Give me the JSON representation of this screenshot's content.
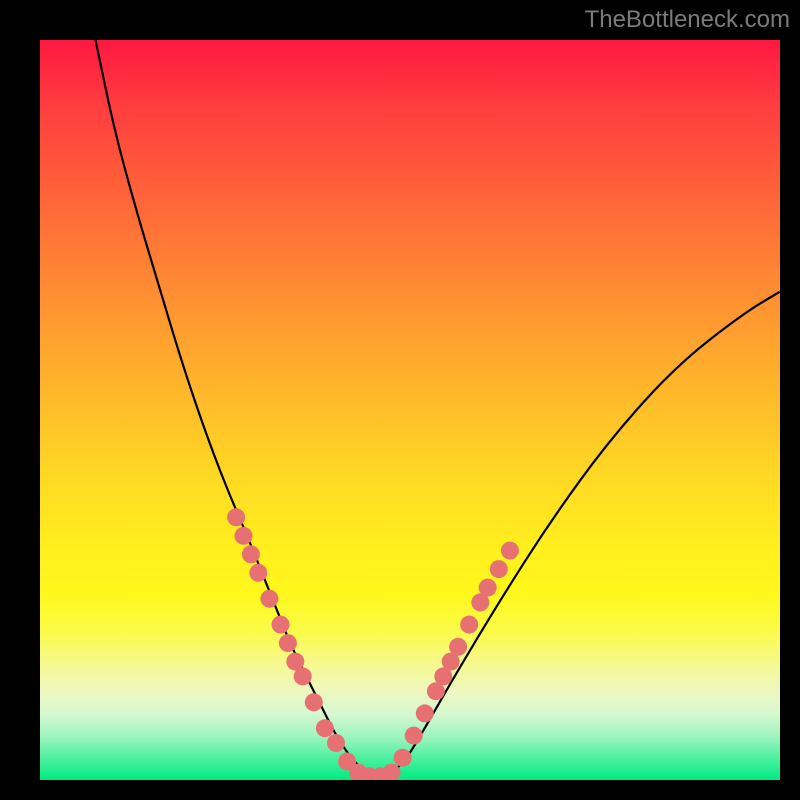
{
  "watermark": "TheBottleneck.com",
  "chart_data": {
    "type": "line",
    "title": "",
    "xlabel": "",
    "ylabel": "",
    "xlim": [
      0,
      1
    ],
    "ylim": [
      0,
      1
    ],
    "curve": {
      "x": [
        0.075,
        0.1,
        0.13,
        0.16,
        0.19,
        0.22,
        0.25,
        0.28,
        0.3,
        0.32,
        0.34,
        0.36,
        0.38,
        0.4,
        0.42,
        0.44,
        0.46,
        0.49,
        0.52,
        0.56,
        0.62,
        0.69,
        0.77,
        0.86,
        0.95,
        1.0
      ],
      "y": [
        1.0,
        0.88,
        0.77,
        0.67,
        0.57,
        0.48,
        0.4,
        0.33,
        0.28,
        0.23,
        0.18,
        0.14,
        0.1,
        0.06,
        0.03,
        0.01,
        0.0,
        0.02,
        0.07,
        0.14,
        0.24,
        0.35,
        0.46,
        0.56,
        0.63,
        0.66
      ]
    },
    "markers": [
      {
        "x": 0.265,
        "y": 0.355
      },
      {
        "x": 0.275,
        "y": 0.33
      },
      {
        "x": 0.285,
        "y": 0.305
      },
      {
        "x": 0.295,
        "y": 0.28
      },
      {
        "x": 0.31,
        "y": 0.245
      },
      {
        "x": 0.325,
        "y": 0.21
      },
      {
        "x": 0.335,
        "y": 0.185
      },
      {
        "x": 0.345,
        "y": 0.16
      },
      {
        "x": 0.355,
        "y": 0.14
      },
      {
        "x": 0.37,
        "y": 0.105
      },
      {
        "x": 0.385,
        "y": 0.07
      },
      {
        "x": 0.4,
        "y": 0.05
      },
      {
        "x": 0.415,
        "y": 0.025
      },
      {
        "x": 0.43,
        "y": 0.01
      },
      {
        "x": 0.445,
        "y": 0.005
      },
      {
        "x": 0.46,
        "y": 0.005
      },
      {
        "x": 0.475,
        "y": 0.01
      },
      {
        "x": 0.49,
        "y": 0.03
      },
      {
        "x": 0.505,
        "y": 0.06
      },
      {
        "x": 0.52,
        "y": 0.09
      },
      {
        "x": 0.535,
        "y": 0.12
      },
      {
        "x": 0.545,
        "y": 0.14
      },
      {
        "x": 0.555,
        "y": 0.16
      },
      {
        "x": 0.565,
        "y": 0.18
      },
      {
        "x": 0.58,
        "y": 0.21
      },
      {
        "x": 0.595,
        "y": 0.24
      },
      {
        "x": 0.605,
        "y": 0.26
      },
      {
        "x": 0.62,
        "y": 0.285
      },
      {
        "x": 0.635,
        "y": 0.31
      }
    ],
    "marker_color": "#e77172",
    "curve_color": "#000000"
  }
}
